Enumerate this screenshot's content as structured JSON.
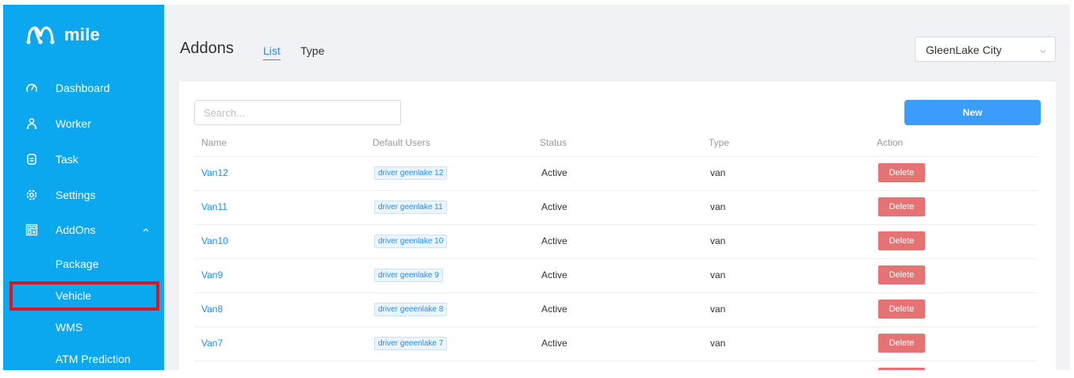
{
  "brand": {
    "name": "mile"
  },
  "sidebar": {
    "items": [
      {
        "label": "Dashboard",
        "icon": "dashboard-icon"
      },
      {
        "label": "Worker",
        "icon": "worker-icon"
      },
      {
        "label": "Task",
        "icon": "task-icon"
      },
      {
        "label": "Settings",
        "icon": "settings-icon"
      },
      {
        "label": "AddOns",
        "icon": "addons-icon",
        "expanded": true
      }
    ],
    "sub_items": [
      {
        "label": "Package"
      },
      {
        "label": "Vehicle",
        "highlighted": true
      },
      {
        "label": "WMS"
      },
      {
        "label": "ATM Prediction"
      }
    ]
  },
  "header": {
    "title": "Addons",
    "tabs": [
      {
        "label": "List",
        "active": true
      },
      {
        "label": "Type"
      }
    ],
    "city_select": {
      "value": "GleenLake City"
    }
  },
  "toolbar": {
    "search_placeholder": "Search...",
    "new_label": "New"
  },
  "table": {
    "columns": [
      "Name",
      "Default Users",
      "Status",
      "Type",
      "Action"
    ],
    "rows": [
      {
        "name": "Van12",
        "user": "driver geenlake 12",
        "status": "Active",
        "type": "van",
        "action": "Delete"
      },
      {
        "name": "Van11",
        "user": "driver geenlake 11",
        "status": "Active",
        "type": "van",
        "action": "Delete"
      },
      {
        "name": "Van10",
        "user": "driver geenlake 10",
        "status": "Active",
        "type": "van",
        "action": "Delete"
      },
      {
        "name": "Van9",
        "user": "driver geenlake 9",
        "status": "Active",
        "type": "van",
        "action": "Delete"
      },
      {
        "name": "Van8",
        "user": "driver geeenlake 8",
        "status": "Active",
        "type": "van",
        "action": "Delete"
      },
      {
        "name": "Van7",
        "user": "driver geeenlake 7",
        "status": "Active",
        "type": "van",
        "action": "Delete"
      }
    ]
  },
  "colors": {
    "sidebar_bg": "#0ba7ef",
    "primary": "#3b9cfb",
    "link": "#1890ff",
    "danger": "#e57373",
    "highlight_border": "#e0161e"
  }
}
